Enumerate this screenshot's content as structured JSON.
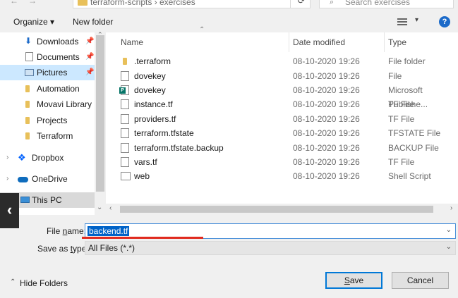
{
  "address_bar": {
    "path_segments": [
      "terraform-scripts",
      "exercises"
    ],
    "path_display": "terraform-scripts  ›  exercises",
    "search_placeholder": "Search exercises"
  },
  "toolbar": {
    "organize_label": "Organize ▾",
    "new_folder_label": "New folder",
    "help_label": "?"
  },
  "nav": {
    "items": [
      {
        "label": "Downloads",
        "pinned": true,
        "icon": "download-icon"
      },
      {
        "label": "Documents",
        "pinned": true,
        "icon": "document-icon"
      },
      {
        "label": "Pictures",
        "pinned": true,
        "icon": "picture-icon",
        "selected": true
      },
      {
        "label": "Automation",
        "icon": "folder-icon"
      },
      {
        "label": "Movavi Library",
        "icon": "folder-icon"
      },
      {
        "label": "Projects",
        "icon": "folder-icon"
      },
      {
        "label": "Terraform",
        "icon": "folder-icon"
      },
      {
        "label": "Dropbox",
        "icon": "dropbox-icon"
      },
      {
        "label": "OneDrive",
        "icon": "cloud-icon"
      },
      {
        "label": "This PC",
        "icon": "computer-icon"
      }
    ]
  },
  "columns": {
    "name": "Name",
    "date": "Date modified",
    "type": "Type"
  },
  "files": [
    {
      "name": ".terraform",
      "date": "08-10-2020 19:26",
      "type": "File folder",
      "icon": "folder-icon"
    },
    {
      "name": "dovekey",
      "date": "08-10-2020 19:26",
      "type": "File",
      "icon": "file-icon"
    },
    {
      "name": "dovekey",
      "date": "08-10-2020 19:26",
      "type": "Microsoft Publishe...",
      "icon": "publisher-icon"
    },
    {
      "name": "instance.tf",
      "date": "08-10-2020 19:26",
      "type": "TF File",
      "icon": "file-icon"
    },
    {
      "name": "providers.tf",
      "date": "08-10-2020 19:26",
      "type": "TF File",
      "icon": "file-icon"
    },
    {
      "name": "terraform.tfstate",
      "date": "08-10-2020 19:26",
      "type": "TFSTATE File",
      "icon": "file-icon"
    },
    {
      "name": "terraform.tfstate.backup",
      "date": "08-10-2020 19:26",
      "type": "BACKUP File",
      "icon": "file-icon"
    },
    {
      "name": "vars.tf",
      "date": "08-10-2020 19:26",
      "type": "TF File",
      "icon": "file-icon"
    },
    {
      "name": "web",
      "date": "08-10-2020 19:26",
      "type": "Shell Script",
      "icon": "shell-script-icon"
    }
  ],
  "form": {
    "file_name_label_pre": "File ",
    "file_name_label_key": "n",
    "file_name_label_post": "ame:",
    "file_name_value": "backend.tf",
    "save_type_label_pre": "Save as ",
    "save_type_label_key": "t",
    "save_type_label_post": "ype:",
    "save_type_value": "All Files (*.*)"
  },
  "footer": {
    "hide_folders_label": "Hide Folders",
    "save_key": "S",
    "save_rest": "ave",
    "cancel_label": "Cancel"
  },
  "colors": {
    "accent": "#0078d7",
    "highlight_line": "#e02a1e",
    "selected_nav": "#cce8ff"
  }
}
